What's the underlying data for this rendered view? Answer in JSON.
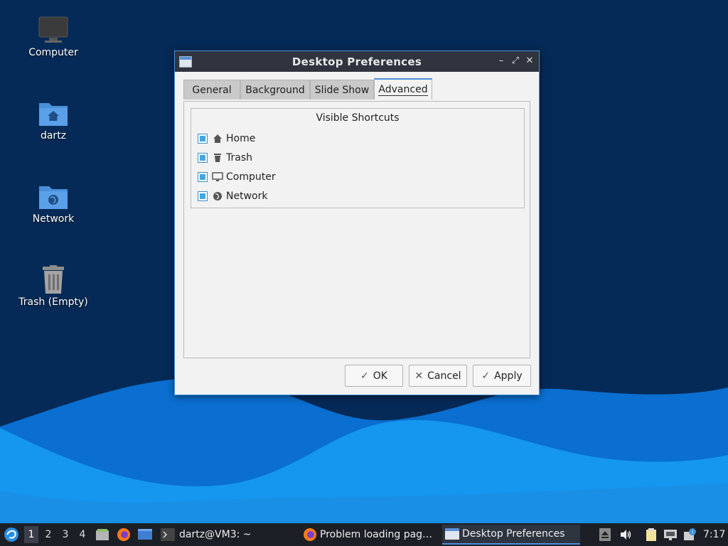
{
  "desktop": {
    "icons": [
      {
        "label": "Computer",
        "icon": "monitor-icon"
      },
      {
        "label": "dartz",
        "icon": "home-folder-icon"
      },
      {
        "label": "Network",
        "icon": "network-folder-icon"
      },
      {
        "label": "Trash (Empty)",
        "icon": "trash-icon"
      }
    ]
  },
  "dialog": {
    "title": "Desktop Preferences",
    "window_buttons": {
      "minimize": "–",
      "maximize": "⤢",
      "close": "✕"
    },
    "tabs": [
      {
        "label": "General",
        "active": false
      },
      {
        "label": "Background",
        "active": false
      },
      {
        "label": "Slide Show",
        "active": false
      },
      {
        "label": "Advanced",
        "active": true
      }
    ],
    "frame_title": "Visible Shortcuts",
    "shortcuts": [
      {
        "label": "Home",
        "checked": true,
        "icon": "home-icon"
      },
      {
        "label": "Trash",
        "checked": true,
        "icon": "trash-icon"
      },
      {
        "label": "Computer",
        "checked": true,
        "icon": "monitor-icon"
      },
      {
        "label": "Network",
        "checked": true,
        "icon": "globe-icon"
      }
    ],
    "buttons": {
      "ok": "OK",
      "cancel": "Cancel",
      "apply": "Apply"
    }
  },
  "taskbar": {
    "workspaces": [
      "1",
      "2",
      "3",
      "4"
    ],
    "active_workspace": "1",
    "tasks": [
      {
        "label": "dartz@VM3: ~",
        "icon": "terminal-icon"
      },
      {
        "label": "Problem loading pag…",
        "icon": "firefox-icon"
      },
      {
        "label": "Desktop Preferences",
        "icon": "window-icon",
        "active": true
      }
    ],
    "clock": "7:17"
  },
  "colors": {
    "accent": "#4a90d9",
    "titlebar": "#2f343f",
    "taskbar": "#1c1f26",
    "checkbox_fill": "#43a7e0"
  }
}
